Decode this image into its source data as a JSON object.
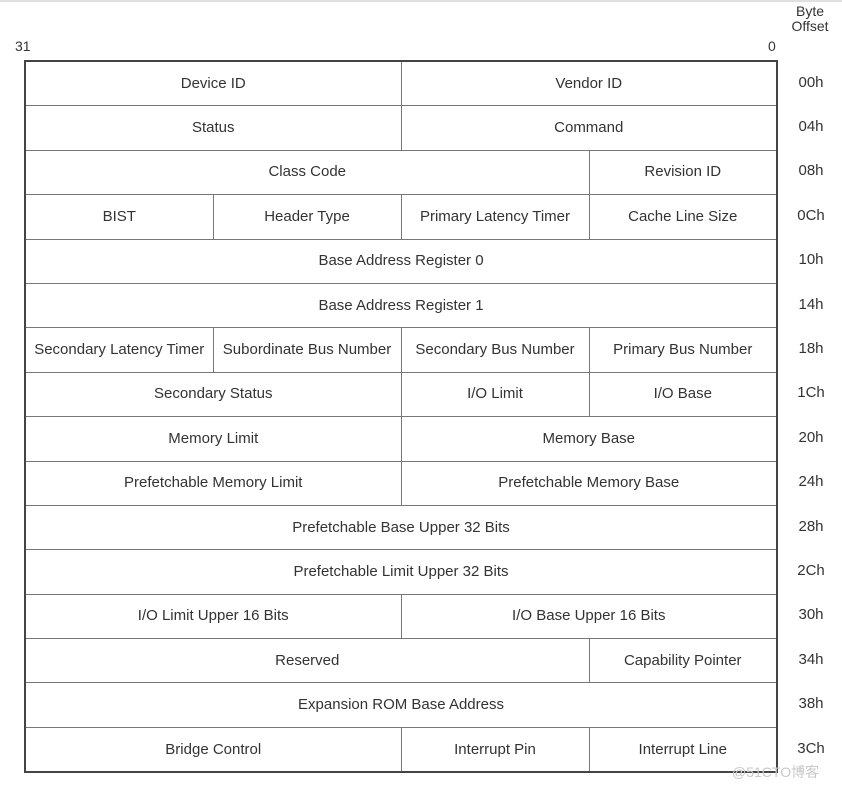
{
  "header": {
    "bit_high": "31",
    "bit_low": "0",
    "byte_offset_line1": "Byte",
    "byte_offset_line2": "Offset"
  },
  "rows": [
    {
      "offset": "00h",
      "cells": [
        {
          "label": "Device ID",
          "span": 2
        },
        {
          "label": "Vendor ID",
          "span": 2
        }
      ]
    },
    {
      "offset": "04h",
      "cells": [
        {
          "label": "Status",
          "span": 2
        },
        {
          "label": "Command",
          "span": 2
        }
      ]
    },
    {
      "offset": "08h",
      "cells": [
        {
          "label": "Class Code",
          "span": 3
        },
        {
          "label": "Revision ID",
          "span": 1
        }
      ]
    },
    {
      "offset": "0Ch",
      "cells": [
        {
          "label": "BIST",
          "span": 1
        },
        {
          "label": "Header Type",
          "span": 1
        },
        {
          "label": "Primary Latency Timer",
          "span": 1
        },
        {
          "label": "Cache Line Size",
          "span": 1
        }
      ]
    },
    {
      "offset": "10h",
      "cells": [
        {
          "label": "Base Address Register 0",
          "span": 4
        }
      ]
    },
    {
      "offset": "14h",
      "cells": [
        {
          "label": "Base Address Register 1",
          "span": 4
        }
      ]
    },
    {
      "offset": "18h",
      "cells": [
        {
          "label": "Secondary Latency Timer",
          "span": 1
        },
        {
          "label": "Subordinate Bus Number",
          "span": 1
        },
        {
          "label": "Secondary Bus Number",
          "span": 1
        },
        {
          "label": "Primary Bus Number",
          "span": 1
        }
      ]
    },
    {
      "offset": "1Ch",
      "cells": [
        {
          "label": "Secondary Status",
          "span": 2
        },
        {
          "label": "I/O Limit",
          "span": 1
        },
        {
          "label": "I/O Base",
          "span": 1
        }
      ]
    },
    {
      "offset": "20h",
      "cells": [
        {
          "label": "Memory Limit",
          "span": 2
        },
        {
          "label": "Memory Base",
          "span": 2
        }
      ]
    },
    {
      "offset": "24h",
      "cells": [
        {
          "label": "Prefetchable Memory Limit",
          "span": 2
        },
        {
          "label": "Prefetchable Memory Base",
          "span": 2
        }
      ]
    },
    {
      "offset": "28h",
      "cells": [
        {
          "label": "Prefetchable Base Upper 32 Bits",
          "span": 4
        }
      ]
    },
    {
      "offset": "2Ch",
      "cells": [
        {
          "label": "Prefetchable Limit Upper 32 Bits",
          "span": 4
        }
      ]
    },
    {
      "offset": "30h",
      "cells": [
        {
          "label": "I/O Limit Upper 16 Bits",
          "span": 2
        },
        {
          "label": "I/O Base Upper 16 Bits",
          "span": 2
        }
      ]
    },
    {
      "offset": "34h",
      "cells": [
        {
          "label": "Reserved",
          "span": 3
        },
        {
          "label": "Capability Pointer",
          "span": 1
        }
      ]
    },
    {
      "offset": "38h",
      "cells": [
        {
          "label": "Expansion ROM Base Address",
          "span": 4
        }
      ]
    },
    {
      "offset": "3Ch",
      "cells": [
        {
          "label": "Bridge Control",
          "span": 2
        },
        {
          "label": "Interrupt Pin",
          "span": 1
        },
        {
          "label": "Interrupt Line",
          "span": 1
        }
      ]
    }
  ],
  "watermark": "@51CTO博客"
}
